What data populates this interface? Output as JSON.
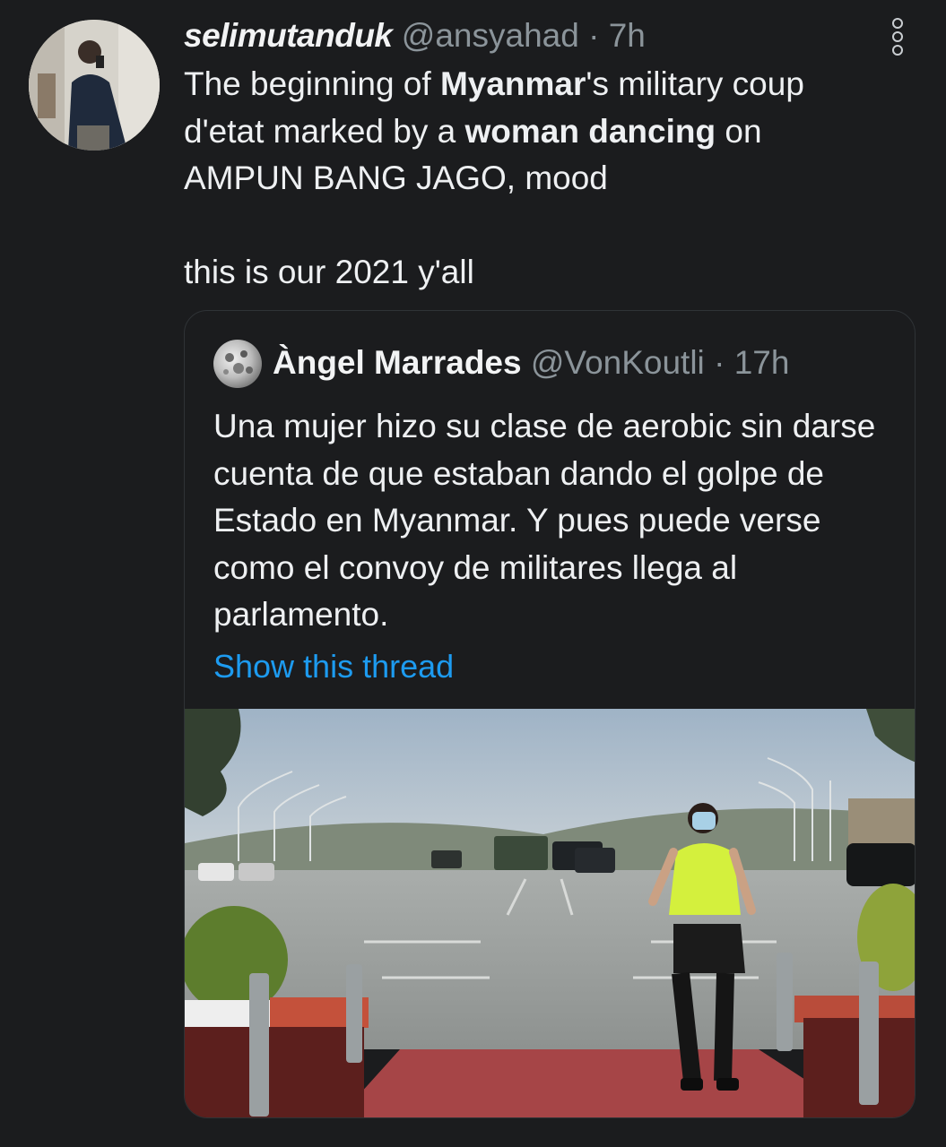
{
  "tweet": {
    "display_name": "selimutanduk",
    "handle": "@ansyahad",
    "separator": "·",
    "time": "7h",
    "text": {
      "p1": "The beginning of ",
      "b1": "Myanmar",
      "p2": "'s military coup d'etat marked by a ",
      "b2": "woman dancing",
      "p3": " on AMPUN BANG JAGO, mood"
    },
    "text_line2": "this is our 2021 y'all",
    "avatar_icon": "user-photo",
    "menu_icon": "more-vertical-icon"
  },
  "quote": {
    "display_name": "Àngel Marrades",
    "handle": "@VonKoutli",
    "separator": "·",
    "time": "17h",
    "text": "Una mujer hizo su clase de aerobic sin darse cuenta de que estaban dando el golpe de Estado en Myanmar. Y pues puede verse como el convoy de militares llega al parlamento.",
    "show_thread": "Show this thread",
    "link_color": "#1d9bf0"
  },
  "colors": {
    "background": "#1b1c1e",
    "text": "#eef0f2",
    "muted": "#8b949a",
    "border": "#2f3336"
  }
}
